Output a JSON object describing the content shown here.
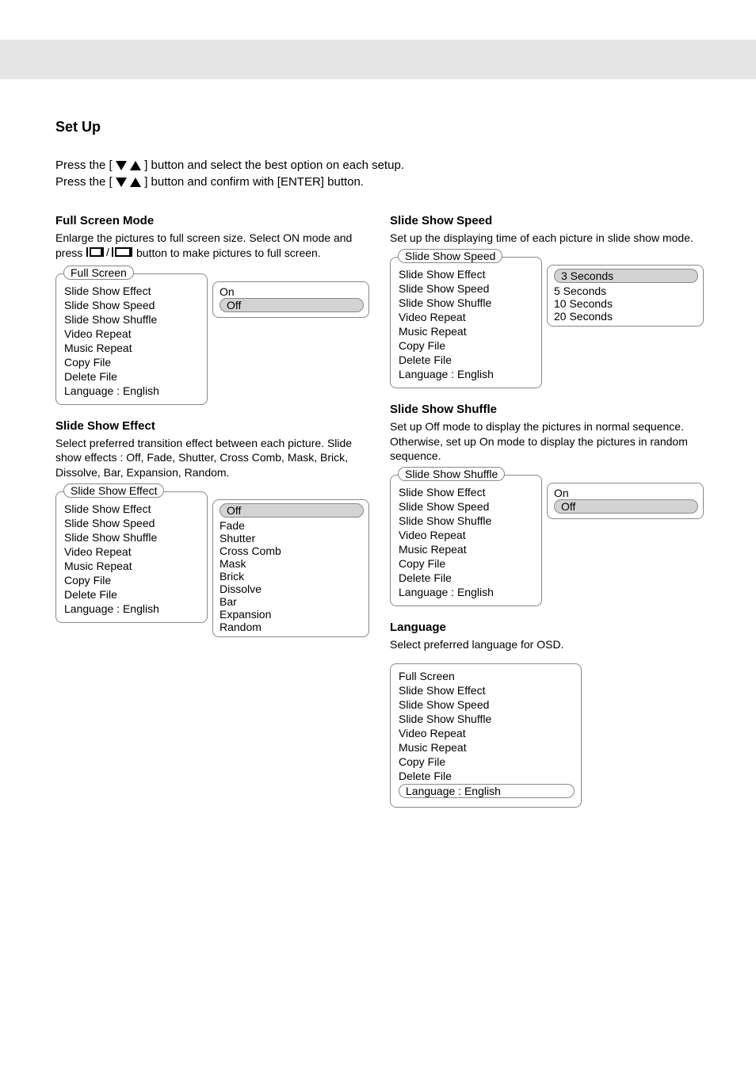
{
  "section_title": "Set Up",
  "intro_lines": "Press the [ ▼ ▲ ] button and select the best option on each setup.\nPress the [ ▼ ▲ ] button and confirm with [ENTER] button.",
  "menu_items": {
    "full_screen": "Full Screen",
    "slide_show_effect": "Slide Show Effect",
    "slide_show_speed": "Slide Show Speed",
    "slide_show_shuffle": "Slide Show Shuffle",
    "video_repeat": "Video Repeat",
    "music_repeat": "Music Repeat",
    "copy_file": "Copy File",
    "delete_file": "Delete File",
    "language": "Language : English"
  },
  "on_off": {
    "on": "On",
    "off": "Off"
  },
  "effects": {
    "off": "Off",
    "fade": "Fade",
    "shutter": "Shutter",
    "cross_comb": "Cross Comb",
    "mask": "Mask",
    "brick": "Brick",
    "dissolve": "Dissolve",
    "bar": "Bar",
    "expansion": "Expansion",
    "random": "Random"
  },
  "speeds": {
    "s3": "3 Seconds",
    "s5": "5 Seconds",
    "s10": "10 Seconds",
    "s20": "20 Seconds"
  },
  "left": {
    "full_screen": {
      "title": "Full Screen Mode",
      "body_prefix": "Enlarge the pictures to full screen size. Select ON mode and press ",
      "body_suffix": " button to make pictures to full screen."
    },
    "slide_show_effect": {
      "title": "Slide Show Effect",
      "body": "Select preferred transition effect between each picture. Slide show effects : Off, Fade, Shutter, Cross Comb, Mask, Brick, Dissolve, Bar, Expansion, Random."
    }
  },
  "right": {
    "slide_show_speed": {
      "title": "Slide Show Speed",
      "body": "Set up the displaying time of each picture in slide show mode."
    },
    "slide_show_shuffle": {
      "title": "Slide Show Shuffle",
      "body": "Set up Off mode to display the pictures in normal sequence. Otherwise, set up On mode to display the pictures in random sequence."
    },
    "language": {
      "title": "Language",
      "body": "Select preferred language for OSD."
    }
  }
}
